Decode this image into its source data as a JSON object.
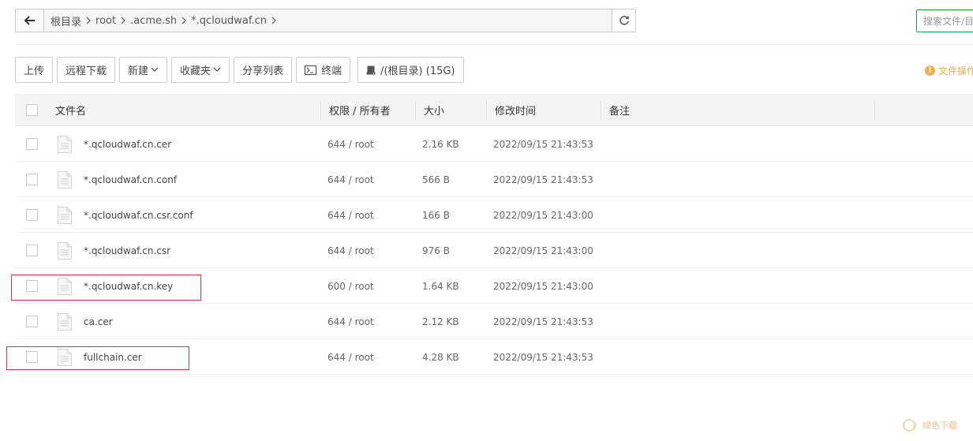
{
  "pathbar": {
    "crumbs": [
      "根目录",
      "root",
      ".acme.sh",
      "*.qcloudwaf.cn"
    ]
  },
  "search": {
    "placeholder": "搜索文件/目"
  },
  "toolbar": {
    "upload": "上传",
    "remote_download": "远程下载",
    "new": "新建",
    "favorites": "收藏夹",
    "share_list": "分享列表",
    "terminal": "终端",
    "disk": "/(根目录) (15G)"
  },
  "file_ops": "文件操作",
  "table": {
    "headers": {
      "name": "文件名",
      "perm": "权限 / 所有者",
      "size": "大小",
      "mtime": "修改时间",
      "note": "备注"
    },
    "rows": [
      {
        "name": "*.qcloudwaf.cn.cer",
        "perm": "644 / root",
        "size": "2.16 KB",
        "mtime": "2022/09/15 21:43:53"
      },
      {
        "name": "*.qcloudwaf.cn.conf",
        "perm": "644 / root",
        "size": "566 B",
        "mtime": "2022/09/15 21:43:53"
      },
      {
        "name": "*.qcloudwaf.cn.csr.conf",
        "perm": "644 / root",
        "size": "166 B",
        "mtime": "2022/09/15 21:43:00"
      },
      {
        "name": "*.qcloudwaf.cn.csr",
        "perm": "644 / root",
        "size": "976 B",
        "mtime": "2022/09/15 21:43:00"
      },
      {
        "name": "*.qcloudwaf.cn.key",
        "perm": "600 / root",
        "size": "1.64 KB",
        "mtime": "2022/09/15 21:43:00"
      },
      {
        "name": "ca.cer",
        "perm": "644 / root",
        "size": "2.12 KB",
        "mtime": "2022/09/15 21:43:53"
      },
      {
        "name": "fullchain.cer",
        "perm": "644 / root",
        "size": "4.28 KB",
        "mtime": "2022/09/15 21:43:53"
      }
    ]
  },
  "watermark": "绿色下载",
  "colors": {
    "accent_green": "#20a53a",
    "warning_orange": "#f0ad4e",
    "highlight_red": "#d9383f"
  }
}
